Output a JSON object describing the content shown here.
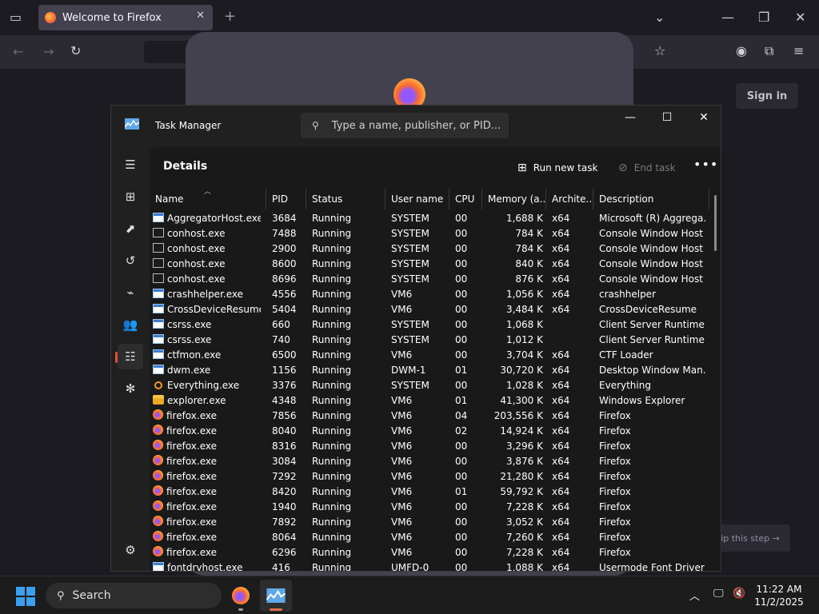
{
  "firefox": {
    "tab_title": "Welcome to Firefox",
    "sign_in": "Sign in",
    "skip_step": "ip this step →"
  },
  "task_manager": {
    "title": "Task Manager",
    "search_placeholder": "Type a name, publisher, or PID...",
    "page_title": "Details",
    "run_new_task": "Run new task",
    "end_task": "End task",
    "columns": [
      "Name",
      "PID",
      "Status",
      "User name",
      "CPU",
      "Memory (a...",
      "Archite...",
      "Description"
    ],
    "processes": [
      {
        "icon": "win",
        "name": "AggregatorHost.exe",
        "pid": "3684",
        "status": "Running",
        "user": "SYSTEM",
        "cpu": "00",
        "mem": "1,688 K",
        "arch": "x64",
        "desc": "Microsoft (R) Aggrega..."
      },
      {
        "icon": "con",
        "name": "conhost.exe",
        "pid": "7488",
        "status": "Running",
        "user": "SYSTEM",
        "cpu": "00",
        "mem": "784 K",
        "arch": "x64",
        "desc": "Console Window Host"
      },
      {
        "icon": "con",
        "name": "conhost.exe",
        "pid": "2900",
        "status": "Running",
        "user": "SYSTEM",
        "cpu": "00",
        "mem": "784 K",
        "arch": "x64",
        "desc": "Console Window Host"
      },
      {
        "icon": "con",
        "name": "conhost.exe",
        "pid": "8600",
        "status": "Running",
        "user": "SYSTEM",
        "cpu": "00",
        "mem": "840 K",
        "arch": "x64",
        "desc": "Console Window Host"
      },
      {
        "icon": "con",
        "name": "conhost.exe",
        "pid": "8696",
        "status": "Running",
        "user": "SYSTEM",
        "cpu": "00",
        "mem": "876 K",
        "arch": "x64",
        "desc": "Console Window Host"
      },
      {
        "icon": "win",
        "name": "crashhelper.exe",
        "pid": "4556",
        "status": "Running",
        "user": "VM6",
        "cpu": "00",
        "mem": "1,056 K",
        "arch": "x64",
        "desc": "crashhelper"
      },
      {
        "icon": "win",
        "name": "CrossDeviceResume....",
        "pid": "5404",
        "status": "Running",
        "user": "VM6",
        "cpu": "00",
        "mem": "3,484 K",
        "arch": "x64",
        "desc": "CrossDeviceResume"
      },
      {
        "icon": "win",
        "name": "csrss.exe",
        "pid": "660",
        "status": "Running",
        "user": "SYSTEM",
        "cpu": "00",
        "mem": "1,068 K",
        "arch": "",
        "desc": "Client Server Runtime ..."
      },
      {
        "icon": "win",
        "name": "csrss.exe",
        "pid": "740",
        "status": "Running",
        "user": "SYSTEM",
        "cpu": "00",
        "mem": "1,012 K",
        "arch": "",
        "desc": "Client Server Runtime ..."
      },
      {
        "icon": "win",
        "name": "ctfmon.exe",
        "pid": "6500",
        "status": "Running",
        "user": "VM6",
        "cpu": "00",
        "mem": "3,704 K",
        "arch": "x64",
        "desc": "CTF Loader"
      },
      {
        "icon": "win",
        "name": "dwm.exe",
        "pid": "1156",
        "status": "Running",
        "user": "DWM-1",
        "cpu": "01",
        "mem": "30,720 K",
        "arch": "x64",
        "desc": "Desktop Window Man..."
      },
      {
        "icon": "search",
        "name": "Everything.exe",
        "pid": "3376",
        "status": "Running",
        "user": "SYSTEM",
        "cpu": "00",
        "mem": "1,028 K",
        "arch": "x64",
        "desc": "Everything"
      },
      {
        "icon": "folder",
        "name": "explorer.exe",
        "pid": "4348",
        "status": "Running",
        "user": "VM6",
        "cpu": "01",
        "mem": "41,300 K",
        "arch": "x64",
        "desc": "Windows Explorer"
      },
      {
        "icon": "ff",
        "name": "firefox.exe",
        "pid": "7856",
        "status": "Running",
        "user": "VM6",
        "cpu": "04",
        "mem": "203,556 K",
        "arch": "x64",
        "desc": "Firefox"
      },
      {
        "icon": "ff",
        "name": "firefox.exe",
        "pid": "8040",
        "status": "Running",
        "user": "VM6",
        "cpu": "02",
        "mem": "14,924 K",
        "arch": "x64",
        "desc": "Firefox"
      },
      {
        "icon": "ff",
        "name": "firefox.exe",
        "pid": "8316",
        "status": "Running",
        "user": "VM6",
        "cpu": "00",
        "mem": "3,296 K",
        "arch": "x64",
        "desc": "Firefox"
      },
      {
        "icon": "ff",
        "name": "firefox.exe",
        "pid": "3084",
        "status": "Running",
        "user": "VM6",
        "cpu": "00",
        "mem": "3,876 K",
        "arch": "x64",
        "desc": "Firefox"
      },
      {
        "icon": "ff",
        "name": "firefox.exe",
        "pid": "7292",
        "status": "Running",
        "user": "VM6",
        "cpu": "00",
        "mem": "21,280 K",
        "arch": "x64",
        "desc": "Firefox"
      },
      {
        "icon": "ff",
        "name": "firefox.exe",
        "pid": "8420",
        "status": "Running",
        "user": "VM6",
        "cpu": "01",
        "mem": "59,792 K",
        "arch": "x64",
        "desc": "Firefox"
      },
      {
        "icon": "ff",
        "name": "firefox.exe",
        "pid": "1940",
        "status": "Running",
        "user": "VM6",
        "cpu": "00",
        "mem": "7,228 K",
        "arch": "x64",
        "desc": "Firefox"
      },
      {
        "icon": "ff",
        "name": "firefox.exe",
        "pid": "7892",
        "status": "Running",
        "user": "VM6",
        "cpu": "00",
        "mem": "3,052 K",
        "arch": "x64",
        "desc": "Firefox"
      },
      {
        "icon": "ff",
        "name": "firefox.exe",
        "pid": "8064",
        "status": "Running",
        "user": "VM6",
        "cpu": "00",
        "mem": "7,260 K",
        "arch": "x64",
        "desc": "Firefox"
      },
      {
        "icon": "ff",
        "name": "firefox.exe",
        "pid": "6296",
        "status": "Running",
        "user": "VM6",
        "cpu": "00",
        "mem": "7,228 K",
        "arch": "x64",
        "desc": "Firefox"
      },
      {
        "icon": "win",
        "name": "fontdrvhost.exe",
        "pid": "416",
        "status": "Running",
        "user": "UMFD-0",
        "cpu": "00",
        "mem": "1,088 K",
        "arch": "x64",
        "desc": "Usermode Font Driver ..."
      }
    ]
  },
  "taskbar": {
    "search_label": "Search",
    "time": "11:22 AM",
    "date": "11/2/2025"
  }
}
